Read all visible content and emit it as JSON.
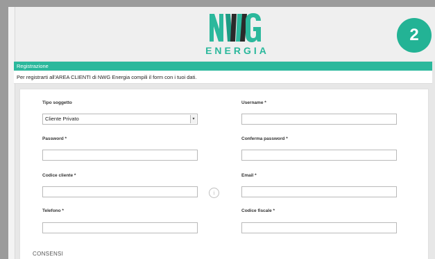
{
  "brand": {
    "logo_text": "ENERGIA",
    "logo_mark_text": "NWG",
    "accent_color": "#2bb89c",
    "logo_dark_color": "#2a2a2a"
  },
  "step": {
    "number": "2"
  },
  "section": {
    "title": "Registrazione"
  },
  "intro": {
    "text": "Per registrarti all'AREA CLIENTI di NWG Energia compili il form con i tuoi dati."
  },
  "form": {
    "tipo_soggetto": {
      "label": "Tipo soggetto",
      "value": "Cliente Privato"
    },
    "username": {
      "label": "Username *",
      "value": ""
    },
    "password": {
      "label": "Password *",
      "value": ""
    },
    "conferma_password": {
      "label": "Conferma password *",
      "value": ""
    },
    "codice_cliente": {
      "label": "Codice cliente *",
      "value": ""
    },
    "email": {
      "label": "Email *",
      "value": ""
    },
    "telefono": {
      "label": "Telefono *",
      "value": ""
    },
    "codice_fiscale": {
      "label": "Codice fiscale *",
      "value": ""
    },
    "info_icon": "info-icon",
    "consensi_title": "CONSENSI"
  }
}
